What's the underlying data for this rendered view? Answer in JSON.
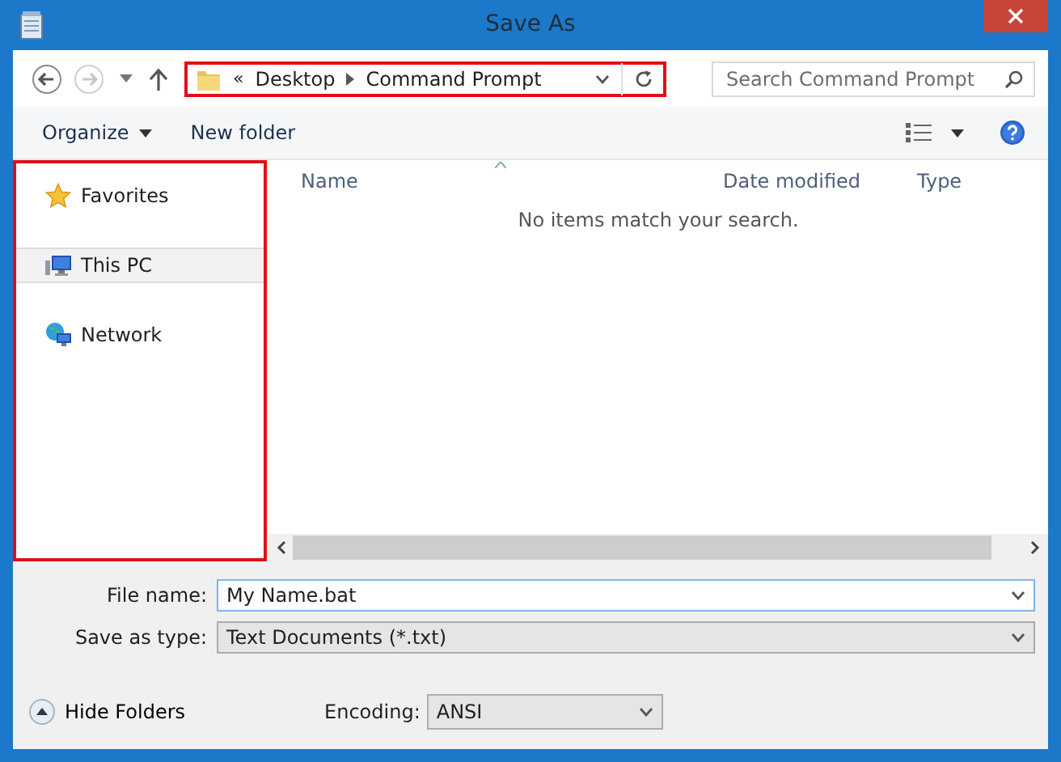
{
  "window": {
    "title": "Save As"
  },
  "address_bar": {
    "overflow": "«",
    "crumbs": [
      "Desktop",
      "Command Prompt"
    ],
    "highlighted": true
  },
  "search": {
    "placeholder": "Search Command Prompt"
  },
  "toolbar": {
    "organize": "Organize",
    "new_folder": "New folder"
  },
  "sidebar": {
    "highlighted": true,
    "items": [
      {
        "label": "Favorites",
        "kind": "favorites",
        "selected": false
      },
      {
        "label": "This PC",
        "kind": "pc",
        "selected": true
      },
      {
        "label": "Network",
        "kind": "network",
        "selected": false
      }
    ]
  },
  "table": {
    "columns": [
      "Name",
      "Date modified",
      "Type"
    ],
    "empty_message": "No items match your search."
  },
  "file_name": {
    "label": "File name:",
    "value": "My Name.bat"
  },
  "save_as_type": {
    "label": "Save as type:",
    "value": "Text Documents (*.txt)"
  },
  "hide_folders": "Hide Folders",
  "encoding": {
    "label": "Encoding:",
    "value": "ANSI"
  }
}
